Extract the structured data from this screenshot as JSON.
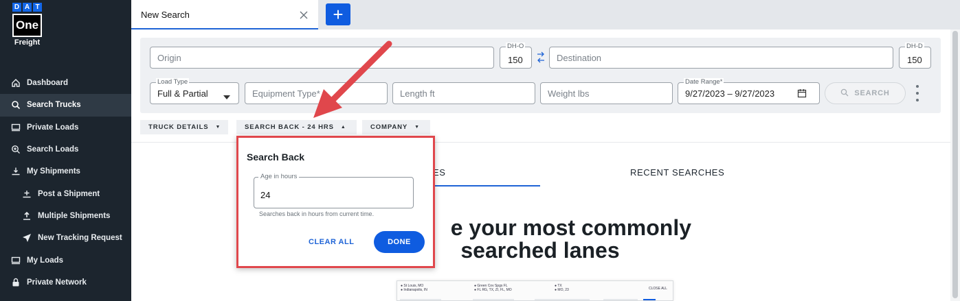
{
  "logo": {
    "letters": [
      "D",
      "A",
      "T"
    ],
    "one": "One",
    "freight": "Freight"
  },
  "sidebar": {
    "items": [
      {
        "label": "Dashboard",
        "icon": "home-icon",
        "sub": false,
        "active": false
      },
      {
        "label": "Search Trucks",
        "icon": "search-icon",
        "sub": false,
        "active": true
      },
      {
        "label": "Private Loads",
        "icon": "truck-icon",
        "sub": false,
        "active": false
      },
      {
        "label": "Search Loads",
        "icon": "search-plus-icon",
        "sub": false,
        "active": false
      },
      {
        "label": "My Shipments",
        "icon": "download-tray-icon",
        "sub": false,
        "active": false
      },
      {
        "label": "Post a Shipment",
        "icon": "plus-tray-icon",
        "sub": true,
        "active": false
      },
      {
        "label": "Multiple Shipments",
        "icon": "upload-icon",
        "sub": true,
        "active": false
      },
      {
        "label": "New Tracking Request",
        "icon": "navigation-arrow-icon",
        "sub": true,
        "active": false
      },
      {
        "label": "My Loads",
        "icon": "truck-icon",
        "sub": false,
        "active": false
      },
      {
        "label": "Private Network",
        "icon": "lock-icon",
        "sub": false,
        "active": false
      }
    ]
  },
  "tabs": {
    "active_label": "New Search"
  },
  "form": {
    "origin_placeholder": "Origin",
    "dho_label": "DH-O",
    "dho_value": "150",
    "destination_placeholder": "Destination",
    "dhd_label": "DH-D",
    "dhd_value": "150",
    "load_type_label": "Load Type",
    "load_type_value": "Full & Partial",
    "equipment_placeholder": "Equipment Type*",
    "length_placeholder": "Length ft",
    "weight_placeholder": "Weight lbs",
    "date_label": "Date Range*",
    "date_value": "9/27/2023 – 9/27/2023",
    "search_label": "SEARCH"
  },
  "chips": {
    "truck_details": "TRUCK DETAILS",
    "search_back": "SEARCH BACK - 24 HRS",
    "company": "COMPANY"
  },
  "main": {
    "tab_left_partial": "ES",
    "tab_recent": "RECENT SEARCHES",
    "headline_line1": "e your most commonly",
    "headline_line2": "searched lanes"
  },
  "preview": {
    "cells": [
      "● St Louis, MO\n● Indianapolis, IN",
      "● Green Cov Spgs FL\n● FL RG, TX, ZI, FL, MO",
      "● TX\n● MO, 23"
    ],
    "close_all": "CLOSE ALL"
  },
  "popup": {
    "title": "Search Back",
    "age_label": "Age in hours",
    "age_value": "24",
    "helper": "Searches back in hours from current time.",
    "clear_label": "CLEAR ALL",
    "done_label": "DONE"
  },
  "colors": {
    "accent": "#0f5ce0",
    "sidebar_bg": "#1c252e",
    "highlight_red": "#e0474c"
  }
}
